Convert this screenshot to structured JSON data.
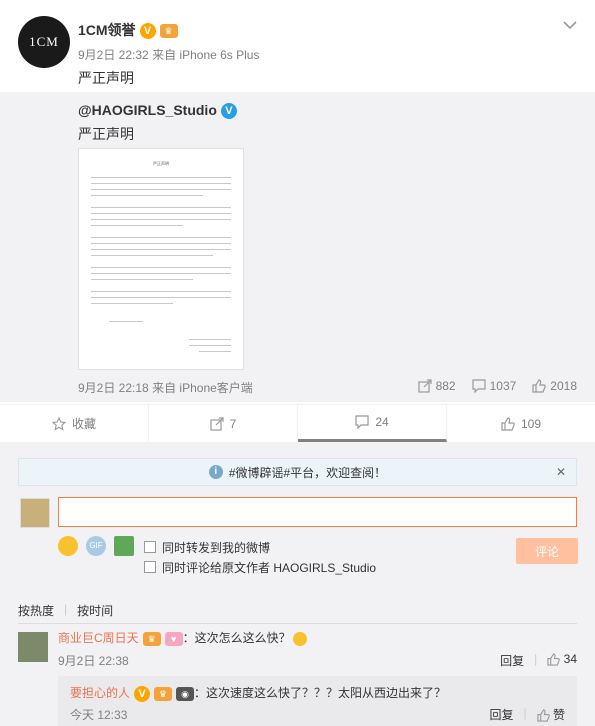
{
  "post": {
    "avatar_text": "1CM",
    "author": "1CM领誉",
    "time": "9月2日 22:32",
    "source_prefix": "来自",
    "source": "iPhone 6s Plus",
    "text": "严正声明"
  },
  "repost": {
    "author": "@HAOGIRLS_Studio",
    "text": "严正声明",
    "doc_title": "严正声明",
    "time": "9月2日 22:18",
    "source_prefix": "来自",
    "source": "iPhone客户端",
    "reposts": "882",
    "comments": "1037",
    "likes": "2018"
  },
  "actions": {
    "favorite": "收藏",
    "repost": "7",
    "comment": "24",
    "like": "109"
  },
  "comment_box": {
    "notice": "#微博辟谣#平台，欢迎查阅！",
    "input_value": "",
    "option_repost": "同时转发到我的微博",
    "option_comment_origin": "同时评论给原文作者 HAOGIRLS_Studio",
    "submit": "评论"
  },
  "sort": {
    "hot": "按热度",
    "time": "按时间"
  },
  "comment": {
    "name": "商业巨C周日天",
    "text": "：这次怎么这么快？",
    "time": "9月2日 22:38",
    "reply": "回复",
    "likes": "34"
  },
  "sub_comment": {
    "name": "要担心的人",
    "text": "：这次速度这么快了？？？太阳从西边出来了？",
    "time": "今天 12:33",
    "reply": "回复",
    "like": "赞"
  },
  "colors": {
    "accent": "#fa7d3c",
    "name_link": "#eb7350",
    "verified_orange": "#ffa500",
    "verified_blue": "#27a0e0"
  }
}
